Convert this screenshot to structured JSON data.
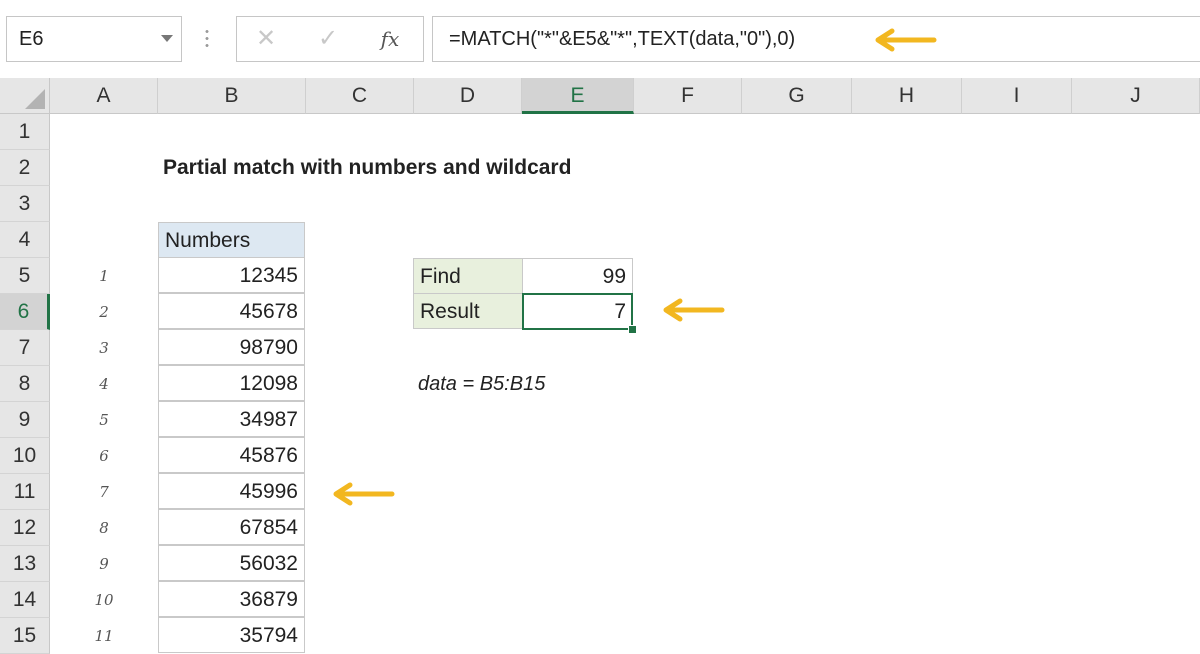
{
  "formula_bar": {
    "name_box": "E6",
    "cancel_icon": "✕",
    "enter_icon": "✓",
    "fx_label": "fx",
    "formula": "=MATCH(\"*\"&E5&\"*\",TEXT(data,\"0\"),0)"
  },
  "columns": [
    "A",
    "B",
    "C",
    "D",
    "E",
    "F",
    "G",
    "H",
    "I",
    "J"
  ],
  "rows": [
    "1",
    "2",
    "3",
    "4",
    "5",
    "6",
    "7",
    "8",
    "9",
    "10",
    "11",
    "12",
    "13",
    "14",
    "15"
  ],
  "active_cell": {
    "column": "E",
    "row": "6"
  },
  "sheet": {
    "title": "Partial match with numbers and wildcard",
    "numbers_header": "Numbers",
    "index_labels": [
      "1",
      "2",
      "3",
      "4",
      "5",
      "6",
      "7",
      "8",
      "9",
      "10",
      "11"
    ],
    "numbers": [
      "12345",
      "45678",
      "98790",
      "12098",
      "34987",
      "45876",
      "45996",
      "67854",
      "56032",
      "36879",
      "35794"
    ],
    "find_label": "Find",
    "find_value": "99",
    "result_label": "Result",
    "result_value": "7",
    "named_range_note": "data = B5:B15"
  },
  "colors": {
    "accent_green": "#217346",
    "arrow": "#f2b720",
    "header_fill": "#dde8f2",
    "label_fill": "#e8f0dd"
  },
  "icons": {
    "namebox_dropdown": "chevron-down-icon",
    "cancel": "close-icon",
    "enter": "check-icon",
    "insert_function": "function-icon",
    "annotation": "arrow-left-icon"
  }
}
